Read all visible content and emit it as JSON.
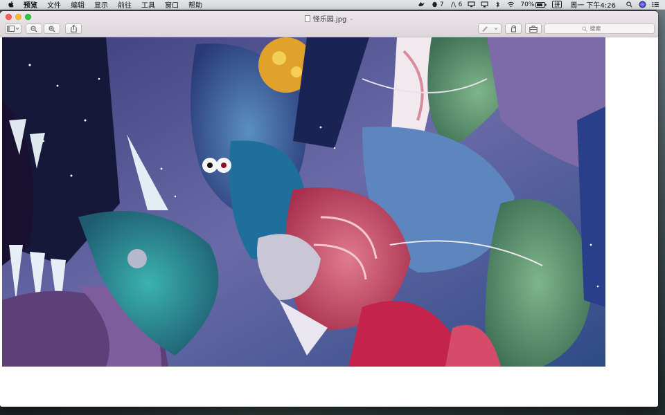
{
  "menubar": {
    "items": [
      "预览",
      "文件",
      "编辑",
      "显示",
      "前往",
      "工具",
      "窗口",
      "帮助"
    ],
    "status": {
      "notify_count": "7",
      "adobe_count": "6",
      "battery": "70%",
      "input_method": "拼",
      "clock": "周一 下午4:26"
    }
  },
  "window": {
    "title": "怪乐园.jpg",
    "search_placeholder": "搜索"
  },
  "colors": {
    "accent_red": "#fc5f57",
    "accent_yellow": "#fdbc2e",
    "accent_green": "#29c840"
  }
}
